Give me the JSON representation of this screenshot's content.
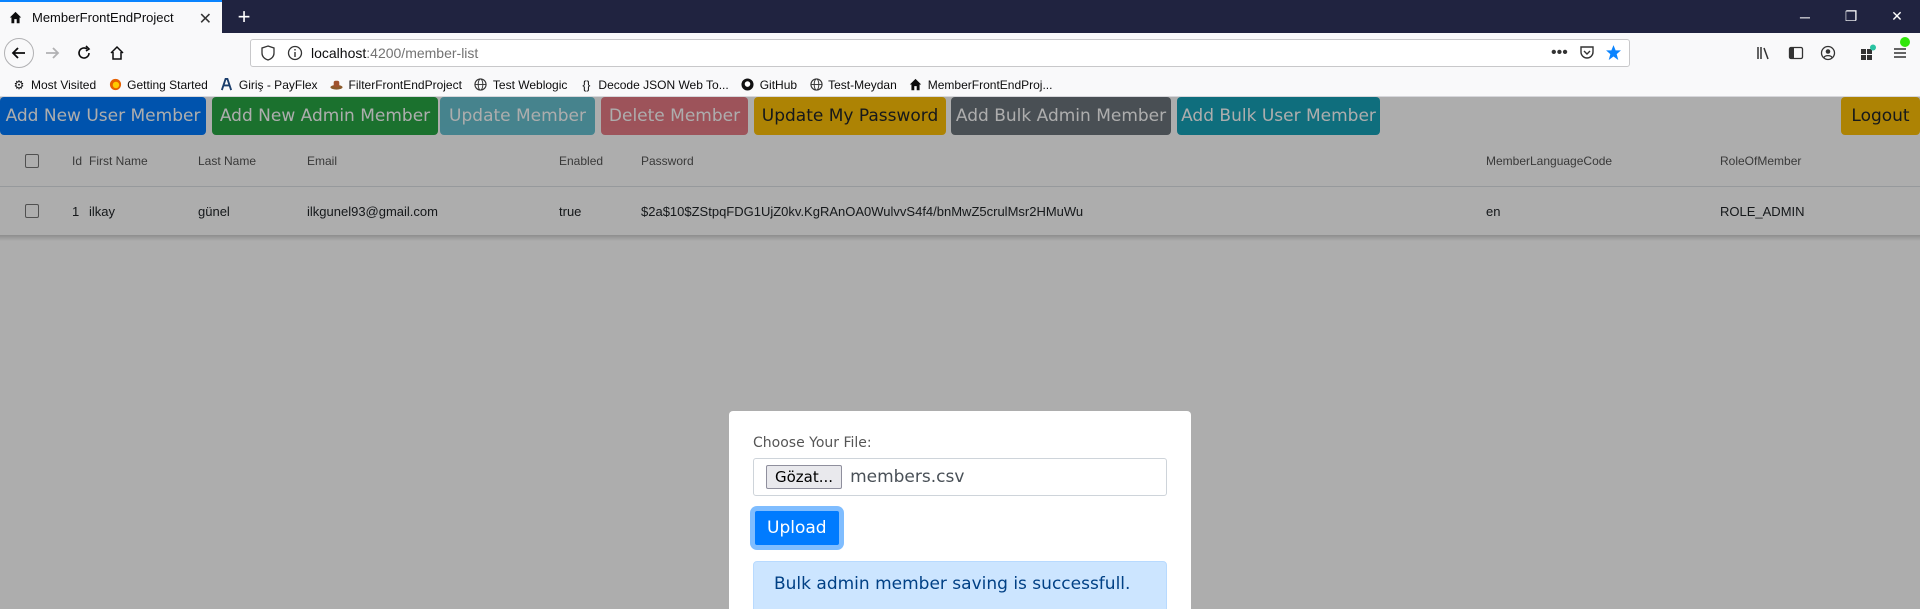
{
  "browser": {
    "tab_title": "MemberFrontEndProject",
    "url_host": "localhost",
    "url_rest": ":4200/member-list",
    "bookmarks": [
      {
        "label": "Most Visited",
        "icon": "gear-icon"
      },
      {
        "label": "Getting Started",
        "icon": "firefox-icon"
      },
      {
        "label": "Giriş - PayFlex",
        "icon": "payflex-icon"
      },
      {
        "label": "FilterFrontEndProject",
        "icon": "hat-icon"
      },
      {
        "label": "Test Weblogic",
        "icon": "globe-icon"
      },
      {
        "label": "Decode JSON Web To...",
        "icon": "braces-icon"
      },
      {
        "label": "GitHub",
        "icon": "github-icon"
      },
      {
        "label": "Test-Meydan",
        "icon": "globe-icon"
      },
      {
        "label": "MemberFrontEndProj...",
        "icon": "home-icon"
      }
    ]
  },
  "actions": {
    "add_user": "Add New User Member",
    "add_admin": "Add New Admin Member",
    "update": "Update Member",
    "delete": "Delete Member",
    "update_password": "Update My Password",
    "bulk_admin": "Add Bulk Admin Member",
    "bulk_user": "Add Bulk User Member",
    "logout": "Logout"
  },
  "colors": {
    "primary": "#007bff",
    "success": "#28a745",
    "info": "#17a2b8",
    "danger": "#dc3545",
    "warning": "#ffc107",
    "secondary": "#6c757d"
  },
  "table": {
    "headers": {
      "id": "Id",
      "first_name": "First Name",
      "last_name": "Last Name",
      "email": "Email",
      "enabled": "Enabled",
      "password": "Password",
      "lang": "MemberLanguageCode",
      "role": "RoleOfMember"
    },
    "rows": [
      {
        "id": "1",
        "first_name": "ilkay",
        "last_name": "günel",
        "email": "ilkgunel93@gmail.com",
        "enabled": "true",
        "password": "$2a$10$ZStpqFDG1UjZ0kv.KgRAnOA0WulvvS4f4/bnMwZ5crulMsr2HMuWu",
        "lang": "en",
        "role": "ROLE_ADMIN"
      }
    ]
  },
  "modal": {
    "label": "Choose Your File:",
    "browse": "Gözat...",
    "filename": "members.csv",
    "upload": "Upload",
    "alert": "Bulk admin member saving is successfull."
  }
}
